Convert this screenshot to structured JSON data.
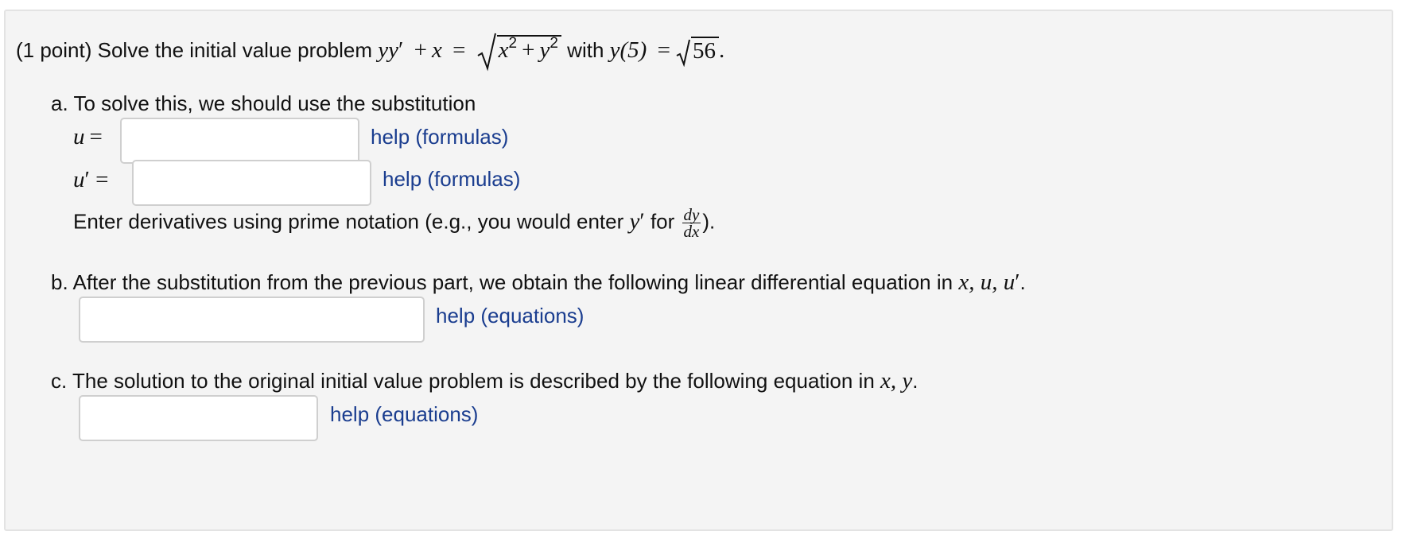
{
  "problem": {
    "points": "(1 point)",
    "intro": "Solve the initial value problem",
    "with_word": "with",
    "lhs_var1": "yy",
    "prime": "′",
    "plus": "+",
    "x": "x",
    "eq": "=",
    "sqrt_x": "x",
    "sqrt_y": "y",
    "exp2": "2",
    "ic_lhs": "y(5)",
    "ic_rhs": "56",
    "period": "."
  },
  "part_a": {
    "label": "a. To solve this, we should use the substitution",
    "u_label": "u =",
    "uprime_u": "u",
    "uprime_rest": "′ =",
    "help1": "help (formulas)",
    "help2": "help (formulas)",
    "note_start": "Enter derivatives using prime notation (e.g., you would enter",
    "note_y": "y",
    "note_prime": "′",
    "note_for": "for",
    "frac_num": "dy",
    "frac_den": "dx",
    "note_end": ")."
  },
  "part_b": {
    "label": "b. After the substitution from the previous part, we obtain the following linear differential equation in",
    "vars": "x, u, u",
    "prime": "′",
    "period": ".",
    "help": "help (equations)"
  },
  "part_c": {
    "label": "c. The solution to the original initial value problem is described by the following equation in",
    "vars": "x, y",
    "period": ".",
    "help": "help (equations)"
  }
}
